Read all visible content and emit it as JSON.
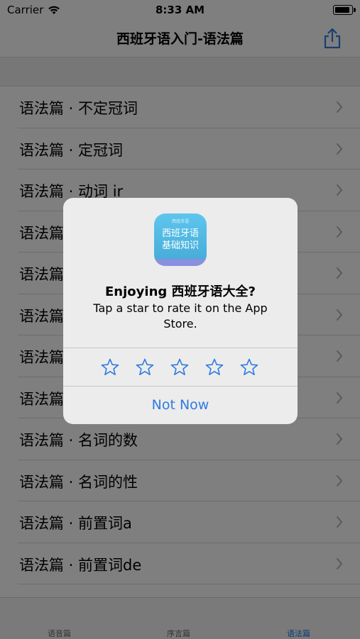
{
  "status": {
    "carrier": "Carrier",
    "time": "8:33 AM"
  },
  "nav": {
    "title": "西班牙语入门-语法篇"
  },
  "list": [
    "语法篇 · 不定冠词",
    "语法篇 · 定冠词",
    "语法篇 · 动词 ir",
    "语法篇",
    "语法篇",
    "语法篇",
    "语法篇",
    "语法篇",
    "语法篇 · 名词的数",
    "语法篇 · 名词的性",
    "语法篇 · 前置词a",
    "语法篇 · 前置词de"
  ],
  "tabs": [
    "语音篇",
    "序言篇",
    "语法篇"
  ],
  "alert": {
    "icon_small_text": "西班牙语",
    "icon_text_line1": "西班牙语",
    "icon_text_line2": "基础知识",
    "title": "Enjoying 西班牙语大全?",
    "message": "Tap a star to rate it on the App Store.",
    "stars": 5,
    "not_now": "Not Now"
  },
  "colors": {
    "accent": "#2f7be0",
    "dimmed_background": "#7f7f7f",
    "alert_background": "#ececec"
  }
}
